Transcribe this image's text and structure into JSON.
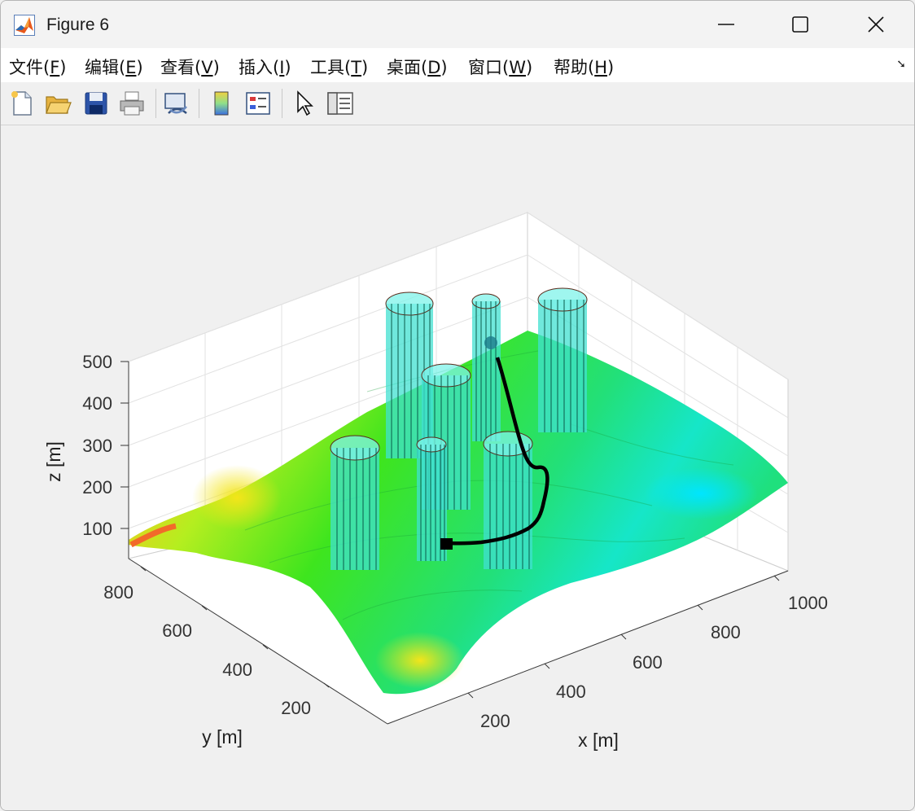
{
  "window": {
    "title": "Figure 6"
  },
  "menu": {
    "items": [
      {
        "text": "文件(",
        "key": "F",
        "tail": ")"
      },
      {
        "text": "编辑(",
        "key": "E",
        "tail": ")"
      },
      {
        "text": "查看(",
        "key": "V",
        "tail": ")"
      },
      {
        "text": "插入(",
        "key": "I",
        "tail": ")"
      },
      {
        "text": "工具(",
        "key": "T",
        "tail": ")"
      },
      {
        "text": "桌面(",
        "key": "D",
        "tail": ")"
      },
      {
        "text": "窗口(",
        "key": "W",
        "tail": ")"
      },
      {
        "text": "帮助(",
        "key": "H",
        "tail": ")"
      }
    ]
  },
  "toolbar": {
    "buttons": [
      "new-figure-icon",
      "open-file-icon",
      "save-icon",
      "print-icon",
      "link-plot-icon",
      "colorbar-icon",
      "legend-icon",
      "edit-plot-icon",
      "property-inspector-icon"
    ]
  },
  "plot": {
    "xlabel": "x [m]",
    "ylabel": "y [m]",
    "zlabel": "z [m]",
    "xticks": [
      "200",
      "400",
      "600",
      "800",
      "1000"
    ],
    "yticks": [
      "200",
      "400",
      "600",
      "800"
    ],
    "zticks": [
      "100",
      "200",
      "300",
      "400",
      "500"
    ],
    "colors": {
      "cylinder_fill": "#40e0d0",
      "path": "#000000"
    }
  },
  "chart_data": {
    "type": "surface",
    "title": "",
    "xlabel": "x [m]",
    "ylabel": "y [m]",
    "zlabel": "z [m]",
    "xlim": [
      0,
      1050
    ],
    "ylim": [
      0,
      900
    ],
    "zlim": [
      0,
      500
    ],
    "grid": true,
    "colormap": "jet",
    "series": []
  }
}
